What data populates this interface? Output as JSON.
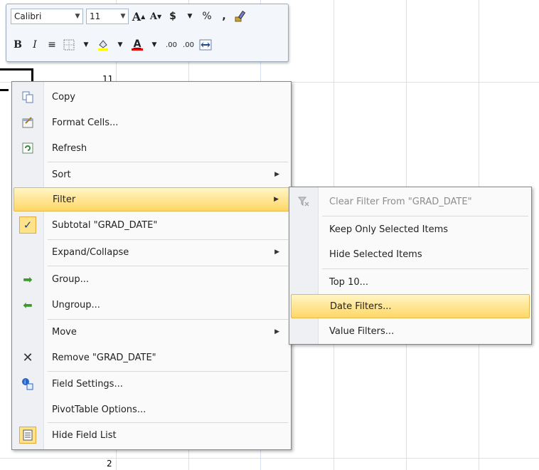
{
  "sheet": {
    "cell_top": "11",
    "cell_bottom": "2"
  },
  "mini_toolbar": {
    "font_name": "Calibri",
    "font_size": "11",
    "grow_font": "A",
    "shrink_font": "A",
    "currency": "$",
    "percent": "%",
    "comma": ",",
    "bold": "B",
    "italic": "I",
    "font_color": "A",
    "increase_decimal": ".00",
    "decrease_decimal": ".00"
  },
  "context_menu": {
    "items": [
      {
        "label": "Copy",
        "icon": "copy-icon"
      },
      {
        "label": "Format Cells...",
        "icon": "format-cells-icon"
      },
      {
        "label": "Refresh",
        "icon": "refresh-icon"
      },
      {
        "label": "Sort",
        "icon": ""
      },
      {
        "label": "Filter",
        "icon": ""
      },
      {
        "label": "Subtotal \"GRAD_DATE\"",
        "icon": "checkmark-icon"
      },
      {
        "label": "Expand/Collapse",
        "icon": ""
      },
      {
        "label": "Group...",
        "icon": "group-arrow-icon"
      },
      {
        "label": "Ungroup...",
        "icon": "ungroup-arrow-icon"
      },
      {
        "label": "Move",
        "icon": ""
      },
      {
        "label": "Remove \"GRAD_DATE\"",
        "icon": "remove-x-icon"
      },
      {
        "label": "Field Settings...",
        "icon": "field-settings-icon"
      },
      {
        "label": "PivotTable Options...",
        "icon": ""
      },
      {
        "label": "Hide Field List",
        "icon": "field-list-icon"
      }
    ]
  },
  "filter_submenu": {
    "items": [
      {
        "label": "Clear Filter From \"GRAD_DATE\"",
        "icon": "clear-filter-icon",
        "disabled": true
      },
      {
        "label": "Keep Only Selected Items"
      },
      {
        "label": "Hide Selected Items"
      },
      {
        "label": "Top 10..."
      },
      {
        "label": "Date Filters..."
      },
      {
        "label": "Value Filters..."
      }
    ]
  },
  "colors": {
    "highlight_top": "#fff5c4",
    "highlight_bottom": "#ffd766",
    "gridline": "#d6e0ee"
  }
}
